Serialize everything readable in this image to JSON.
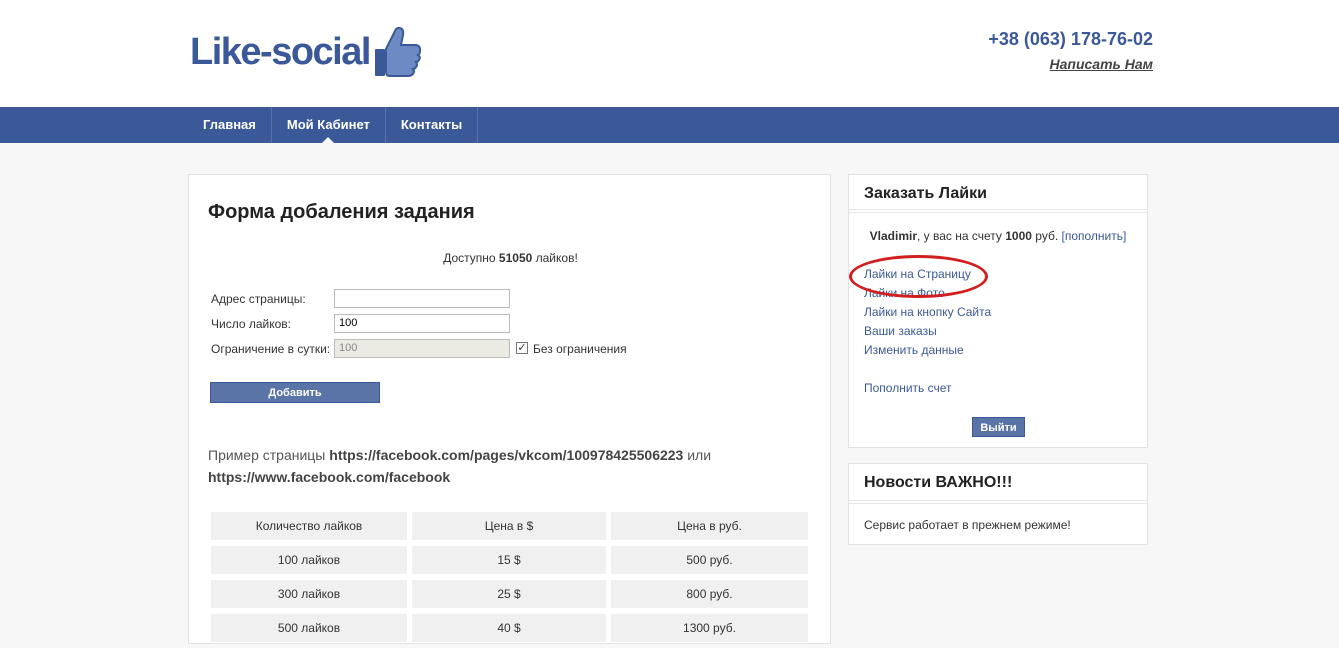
{
  "header": {
    "logo_text": "Like-social",
    "phone": "+38 (063) 178-76-02",
    "write_us": "Написать Нам"
  },
  "nav": {
    "items": [
      "Главная",
      "Мой Кабинет",
      "Контакты"
    ],
    "active": "Мой Кабинет"
  },
  "form": {
    "title": "Форма добаления задания",
    "available_prefix": "Доступно ",
    "available_count": "51050",
    "available_suffix": " лайков!",
    "label_address": "Адрес страницы:",
    "value_address": "",
    "label_likes": "Число лайков:",
    "value_likes": "100",
    "label_limit": "Ограничение в сутки:",
    "value_limit": "100",
    "checkbox_label": "Без ограничения",
    "checkbox_checked": true,
    "add_button": "Добавить"
  },
  "example": {
    "prefix": "Пример страницы ",
    "url1": "https://facebook.com/pages/vkcom/100978425506223",
    "or": " или ",
    "url2": "https://www.facebook.com/facebook"
  },
  "prices": {
    "headers": [
      "Количество лайков",
      "Цена в $",
      "Цена в руб."
    ],
    "rows": [
      [
        "100 лайков",
        "15 $",
        "500 руб."
      ],
      [
        "300 лайков",
        "25 $",
        "800 руб."
      ],
      [
        "500 лайков",
        "40 $",
        "1300 руб."
      ]
    ]
  },
  "sidebar": {
    "order_title": "Заказать Лайки",
    "user_name": "Vladimir",
    "balance_text": ", у вас на счету ",
    "balance_amount": "1000",
    "balance_currency": " руб. ",
    "topup_link": "[пополнить]",
    "links": [
      "Лайки на Страницу",
      "Лайки на Фото",
      "Лайки на кнопку Сайта",
      "Ваши заказы",
      "Изменить данные"
    ],
    "fund_link": "Пополнить счет",
    "logout_button": "Выйти",
    "news_title": "Новости ВАЖНО!!!",
    "news_text": "Сервис работает в прежнем режиме!"
  },
  "colors": {
    "brand": "#3b5998",
    "button": "#5b74a8",
    "highlight": "#d21e1e"
  }
}
